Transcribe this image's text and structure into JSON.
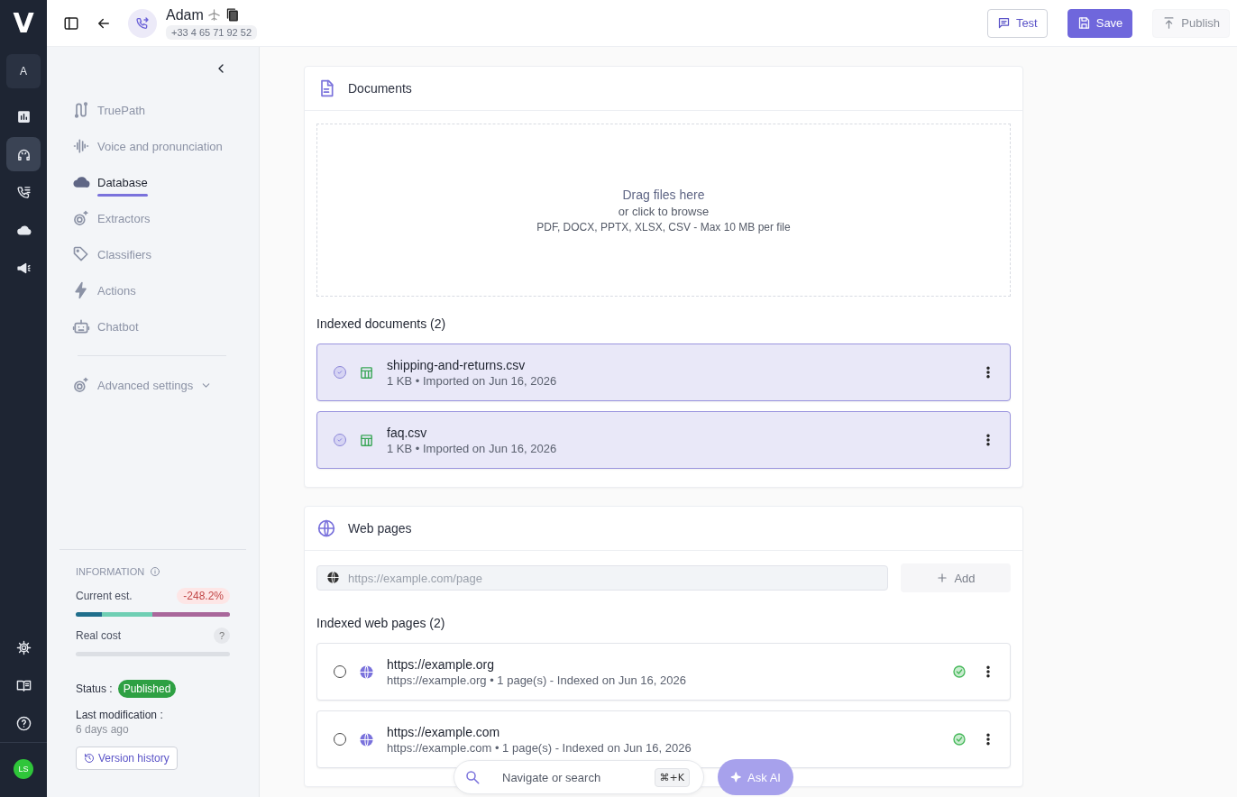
{
  "rail": {
    "logo": "V",
    "workspace": "A",
    "items": [
      {
        "kind": "chart",
        "selected": false
      },
      {
        "kind": "headset",
        "selected": true
      },
      {
        "kind": "calls",
        "selected": false
      },
      {
        "kind": "cloud",
        "selected": false
      },
      {
        "kind": "megaphone",
        "selected": false
      }
    ],
    "bottom": [
      {
        "kind": "settings"
      },
      {
        "kind": "book"
      },
      {
        "kind": "help"
      }
    ],
    "avatar": "LS"
  },
  "header": {
    "title": "Adam",
    "phone": "+33 4 65 71 92 52",
    "buttons": [
      {
        "kind": "test",
        "label": "Test",
        "disabled": false
      },
      {
        "kind": "save",
        "label": "Save",
        "disabled": false
      },
      {
        "kind": "publish",
        "label": "Publish",
        "disabled": true
      }
    ]
  },
  "sidebar": {
    "items": [
      {
        "kind": "path",
        "label": "TruePath",
        "selected": false
      },
      {
        "kind": "wave",
        "label": "Voice and pronunciation",
        "selected": false
      },
      {
        "kind": "cloud",
        "label": "Database",
        "selected": true
      },
      {
        "kind": "gears",
        "label": "Extractors",
        "selected": false
      },
      {
        "kind": "tag",
        "label": "Classifiers",
        "selected": false
      },
      {
        "kind": "bolt",
        "label": "Actions",
        "selected": false
      },
      {
        "kind": "robot",
        "label": "Chatbot",
        "selected": false
      }
    ],
    "advanced": {
      "label": "Advanced settings",
      "expanded": false
    },
    "information": {
      "heading": "INFORMATION",
      "current": {
        "label": "Current est.",
        "badge": "-248.2%",
        "segments": [
          {
            "color": "#1f6e8c",
            "level": 0.17
          },
          {
            "color": "#6fcfb4",
            "level": 0.33
          },
          {
            "color": "#a9679b",
            "level": 0.5
          }
        ]
      },
      "real": {
        "label": "Real cost",
        "badge": "?",
        "level": 0
      },
      "status_label": "Status :",
      "status": "Published",
      "modified_label": "Last modification :",
      "modified": "6 days ago",
      "history": "Version history"
    }
  },
  "documents": {
    "title": "Documents",
    "drop_title": "Drag files here",
    "drop_hint": "or click to browse",
    "drop_types": "PDF, DOCX, PPTX, XLSX, CSV - Max 10 MB per file",
    "list_title": "Indexed documents (2)",
    "items": [
      {
        "name": "shipping-and-returns.csv",
        "meta": "1 KB • Imported on Jun 16, 2026",
        "selected": true
      },
      {
        "name": "faq.csv",
        "meta": "1 KB • Imported on Jun 16, 2026",
        "selected": true
      }
    ]
  },
  "web_pages": {
    "title": "Web pages",
    "placeholder": "https://example.com/page",
    "add": "Add",
    "list_title": "Indexed web pages (2)",
    "items": [
      {
        "name": "https://example.org",
        "meta": "https://example.org • 1 page(s) - Indexed on Jun 16, 2026",
        "selected": false,
        "indexed": true
      },
      {
        "name": "https://example.com",
        "meta": "https://example.com • 1 page(s) - Indexed on Jun 16, 2026",
        "selected": false,
        "indexed": true
      }
    ]
  },
  "command_bar": {
    "placeholder": "Navigate or search",
    "shortcut": "⌘+K",
    "ask": "Ask AI"
  }
}
